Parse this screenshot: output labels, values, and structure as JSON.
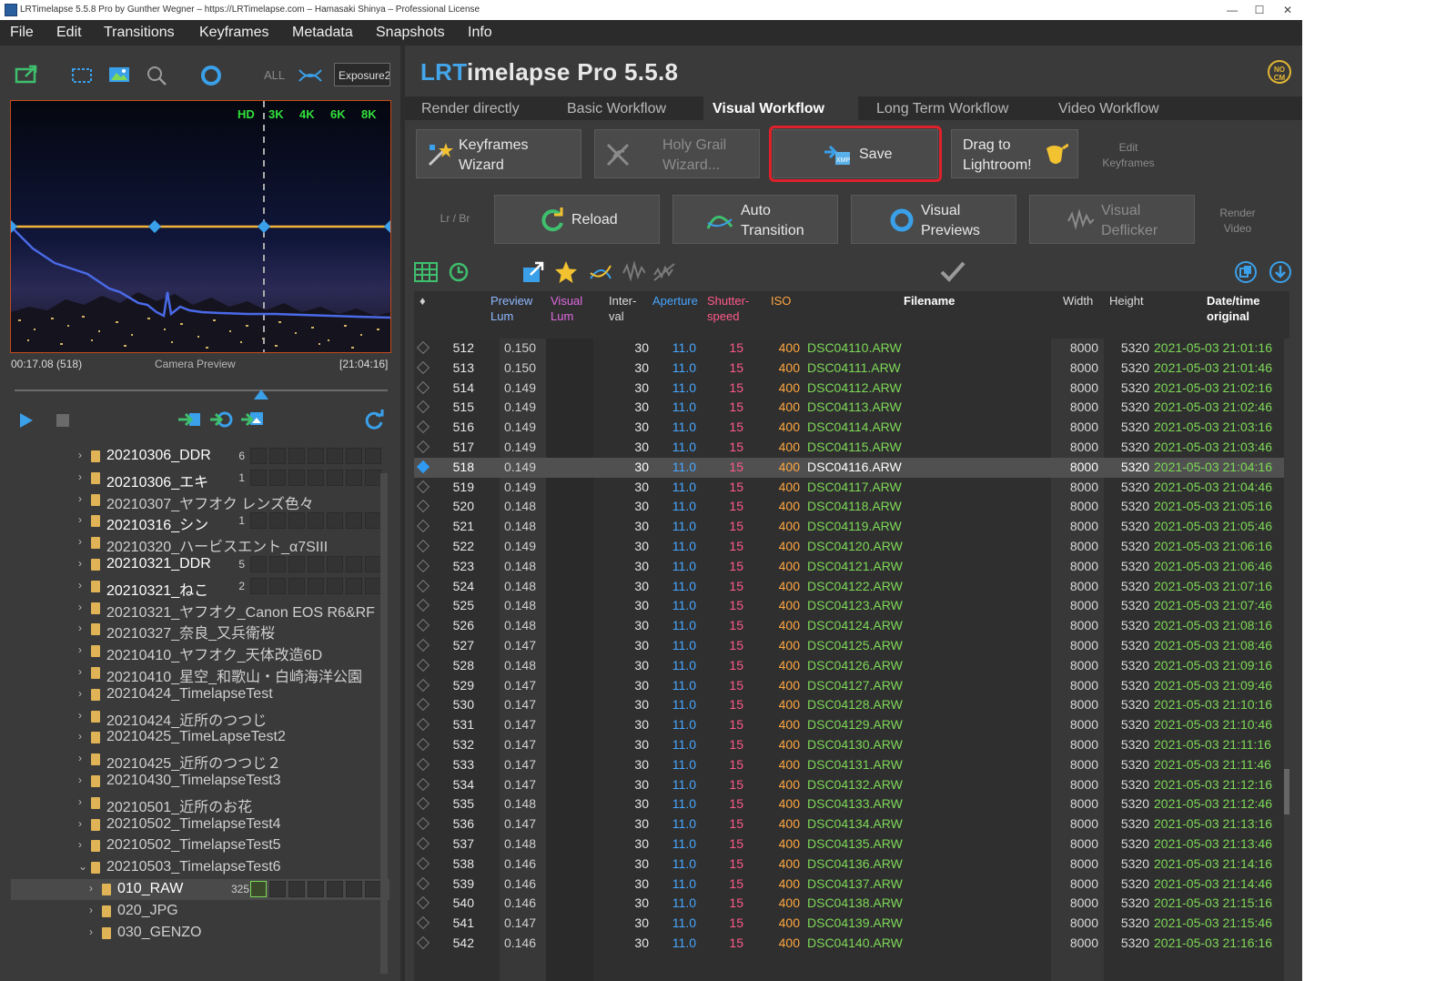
{
  "window": {
    "title": "LRTimelapse 5.5.8 Pro by Gunther Wegner – https://LRTimelapse.com – Hamasaki Shinya – Professional License",
    "minimize": "—",
    "maximize": "☐",
    "close": "✕"
  },
  "menu": [
    "File",
    "Edit",
    "Transitions",
    "Keyframes",
    "Metadata",
    "Snapshots",
    "Info"
  ],
  "left_toolbar": {
    "all_label": "ALL",
    "exposure_select": "Exposure2"
  },
  "preview": {
    "resolutions": [
      "HD",
      "3K",
      "4K",
      "6K",
      "8K"
    ],
    "time_left": "00:17.08 (518)",
    "label": "Camera Preview",
    "time_right": "[21:04:16]"
  },
  "folders": [
    {
      "name": "20210306_DDR",
      "count": "6",
      "bright": true,
      "cells": true
    },
    {
      "name": "20210306_エキ",
      "count": "1",
      "bright": true,
      "cells": true
    },
    {
      "name": "20210307_ヤフオク レンズ色々",
      "count": "",
      "bright": false,
      "cells": false
    },
    {
      "name": "20210316_シン",
      "count": "1",
      "bright": true,
      "cells": true
    },
    {
      "name": "20210320_ハービスエント_α7SIII",
      "count": "",
      "bright": false,
      "cells": false
    },
    {
      "name": "20210321_DDR",
      "count": "5",
      "bright": true,
      "cells": true
    },
    {
      "name": "20210321_ねこ",
      "count": "2",
      "bright": true,
      "cells": true
    },
    {
      "name": "20210321_ヤフオク_Canon EOS R6&RF",
      "count": "",
      "bright": false,
      "cells": false
    },
    {
      "name": "20210327_奈良_又兵衛桜",
      "count": "",
      "bright": false,
      "cells": false
    },
    {
      "name": "20210410_ヤフオク_天体改造6D",
      "count": "",
      "bright": false,
      "cells": false
    },
    {
      "name": "20210410_星空_和歌山・白崎海洋公園",
      "count": "",
      "bright": false,
      "cells": false
    },
    {
      "name": "20210424_TimelapseTest",
      "count": "",
      "bright": false,
      "cells": false
    },
    {
      "name": "20210424_近所のつつじ",
      "count": "",
      "bright": false,
      "cells": false
    },
    {
      "name": "20210425_TimeLapseTest2",
      "count": "",
      "bright": false,
      "cells": false
    },
    {
      "name": "20210425_近所のつつじ２",
      "count": "",
      "bright": false,
      "cells": false
    },
    {
      "name": "20210430_TimelapseTest3",
      "count": "",
      "bright": false,
      "cells": false
    },
    {
      "name": "20210501_近所のお花",
      "count": "",
      "bright": false,
      "cells": false
    },
    {
      "name": "20210502_TimelapseTest4",
      "count": "",
      "bright": false,
      "cells": false
    },
    {
      "name": "20210502_TimelapseTest5",
      "count": "",
      "bright": false,
      "cells": false
    },
    {
      "name": "20210503_TimelapseTest6",
      "count": "",
      "bright": false,
      "cells": false,
      "expanded": true
    },
    {
      "name": "010_RAW",
      "count": "325",
      "bright": true,
      "cells": true,
      "child": true,
      "selected": true
    },
    {
      "name": "020_JPG",
      "count": "",
      "bright": false,
      "cells": false,
      "child": true
    },
    {
      "name": "030_GENZO",
      "count": "",
      "bright": false,
      "cells": false,
      "child": true
    }
  ],
  "app_title": {
    "lrt": "LRT",
    "rest": "imelapse Pro 5.5.8"
  },
  "nocm": "NO CM",
  "tabs": [
    "Render directly",
    "Basic Workflow",
    "Visual Workflow",
    "Long Term Workflow",
    "Video Workflow"
  ],
  "active_tab": "Visual Workflow",
  "workflow_row1": {
    "keyframes_wizard": "Keyframes\nWizard",
    "holy_grail": "Holy Grail\nWizard...",
    "save": "Save",
    "drag_to_lr": "Drag to\nLightroom!",
    "edit_keyframes": "Edit\nKeyframes"
  },
  "workflow_row2": {
    "lr_br": "Lr / Br",
    "reload": "Reload",
    "auto_transition": "Auto\nTransition",
    "visual_previews": "Visual\nPreviews",
    "visual_deflicker": "Visual\nDeflicker",
    "render_video": "Render\nVideo"
  },
  "table": {
    "headers": {
      "sort": "♦",
      "preview_lum": "Preview\nLum",
      "visual_lum": "Visual\nLum",
      "interval": "Inter-\nval",
      "aperture": "Aperture",
      "shutter": "Shutter-\nspeed",
      "iso": "ISO",
      "filename": "Filename",
      "width": "Width",
      "height": "Height",
      "datetime": "Date/time\noriginal"
    },
    "rows": [
      {
        "n": "512",
        "lum": "0.150",
        "iv": "30",
        "ap": "11.0",
        "sh": "15",
        "iso": "400",
        "file": "DSC04110.ARW",
        "w": "8000",
        "h": "5320",
        "dt": "2021-05-03 21:01:16"
      },
      {
        "n": "513",
        "lum": "0.150",
        "iv": "30",
        "ap": "11.0",
        "sh": "15",
        "iso": "400",
        "file": "DSC04111.ARW",
        "w": "8000",
        "h": "5320",
        "dt": "2021-05-03 21:01:46"
      },
      {
        "n": "514",
        "lum": "0.149",
        "iv": "30",
        "ap": "11.0",
        "sh": "15",
        "iso": "400",
        "file": "DSC04112.ARW",
        "w": "8000",
        "h": "5320",
        "dt": "2021-05-03 21:02:16"
      },
      {
        "n": "515",
        "lum": "0.149",
        "iv": "30",
        "ap": "11.0",
        "sh": "15",
        "iso": "400",
        "file": "DSC04113.ARW",
        "w": "8000",
        "h": "5320",
        "dt": "2021-05-03 21:02:46"
      },
      {
        "n": "516",
        "lum": "0.149",
        "iv": "30",
        "ap": "11.0",
        "sh": "15",
        "iso": "400",
        "file": "DSC04114.ARW",
        "w": "8000",
        "h": "5320",
        "dt": "2021-05-03 21:03:16"
      },
      {
        "n": "517",
        "lum": "0.149",
        "iv": "30",
        "ap": "11.0",
        "sh": "15",
        "iso": "400",
        "file": "DSC04115.ARW",
        "w": "8000",
        "h": "5320",
        "dt": "2021-05-03 21:03:46"
      },
      {
        "n": "518",
        "lum": "0.149",
        "iv": "30",
        "ap": "11.0",
        "sh": "15",
        "iso": "400",
        "file": "DSC04116.ARW",
        "w": "8000",
        "h": "5320",
        "dt": "2021-05-03 21:04:16",
        "sel": true,
        "key": true
      },
      {
        "n": "519",
        "lum": "0.149",
        "iv": "30",
        "ap": "11.0",
        "sh": "15",
        "iso": "400",
        "file": "DSC04117.ARW",
        "w": "8000",
        "h": "5320",
        "dt": "2021-05-03 21:04:46"
      },
      {
        "n": "520",
        "lum": "0.148",
        "iv": "30",
        "ap": "11.0",
        "sh": "15",
        "iso": "400",
        "file": "DSC04118.ARW",
        "w": "8000",
        "h": "5320",
        "dt": "2021-05-03 21:05:16"
      },
      {
        "n": "521",
        "lum": "0.148",
        "iv": "30",
        "ap": "11.0",
        "sh": "15",
        "iso": "400",
        "file": "DSC04119.ARW",
        "w": "8000",
        "h": "5320",
        "dt": "2021-05-03 21:05:46"
      },
      {
        "n": "522",
        "lum": "0.149",
        "iv": "30",
        "ap": "11.0",
        "sh": "15",
        "iso": "400",
        "file": "DSC04120.ARW",
        "w": "8000",
        "h": "5320",
        "dt": "2021-05-03 21:06:16"
      },
      {
        "n": "523",
        "lum": "0.148",
        "iv": "30",
        "ap": "11.0",
        "sh": "15",
        "iso": "400",
        "file": "DSC04121.ARW",
        "w": "8000",
        "h": "5320",
        "dt": "2021-05-03 21:06:46"
      },
      {
        "n": "524",
        "lum": "0.148",
        "iv": "30",
        "ap": "11.0",
        "sh": "15",
        "iso": "400",
        "file": "DSC04122.ARW",
        "w": "8000",
        "h": "5320",
        "dt": "2021-05-03 21:07:16"
      },
      {
        "n": "525",
        "lum": "0.148",
        "iv": "30",
        "ap": "11.0",
        "sh": "15",
        "iso": "400",
        "file": "DSC04123.ARW",
        "w": "8000",
        "h": "5320",
        "dt": "2021-05-03 21:07:46"
      },
      {
        "n": "526",
        "lum": "0.148",
        "iv": "30",
        "ap": "11.0",
        "sh": "15",
        "iso": "400",
        "file": "DSC04124.ARW",
        "w": "8000",
        "h": "5320",
        "dt": "2021-05-03 21:08:16"
      },
      {
        "n": "527",
        "lum": "0.147",
        "iv": "30",
        "ap": "11.0",
        "sh": "15",
        "iso": "400",
        "file": "DSC04125.ARW",
        "w": "8000",
        "h": "5320",
        "dt": "2021-05-03 21:08:46"
      },
      {
        "n": "528",
        "lum": "0.148",
        "iv": "30",
        "ap": "11.0",
        "sh": "15",
        "iso": "400",
        "file": "DSC04126.ARW",
        "w": "8000",
        "h": "5320",
        "dt": "2021-05-03 21:09:16"
      },
      {
        "n": "529",
        "lum": "0.147",
        "iv": "30",
        "ap": "11.0",
        "sh": "15",
        "iso": "400",
        "file": "DSC04127.ARW",
        "w": "8000",
        "h": "5320",
        "dt": "2021-05-03 21:09:46"
      },
      {
        "n": "530",
        "lum": "0.147",
        "iv": "30",
        "ap": "11.0",
        "sh": "15",
        "iso": "400",
        "file": "DSC04128.ARW",
        "w": "8000",
        "h": "5320",
        "dt": "2021-05-03 21:10:16"
      },
      {
        "n": "531",
        "lum": "0.147",
        "iv": "30",
        "ap": "11.0",
        "sh": "15",
        "iso": "400",
        "file": "DSC04129.ARW",
        "w": "8000",
        "h": "5320",
        "dt": "2021-05-03 21:10:46"
      },
      {
        "n": "532",
        "lum": "0.147",
        "iv": "30",
        "ap": "11.0",
        "sh": "15",
        "iso": "400",
        "file": "DSC04130.ARW",
        "w": "8000",
        "h": "5320",
        "dt": "2021-05-03 21:11:16"
      },
      {
        "n": "533",
        "lum": "0.147",
        "iv": "30",
        "ap": "11.0",
        "sh": "15",
        "iso": "400",
        "file": "DSC04131.ARW",
        "w": "8000",
        "h": "5320",
        "dt": "2021-05-03 21:11:46"
      },
      {
        "n": "534",
        "lum": "0.147",
        "iv": "30",
        "ap": "11.0",
        "sh": "15",
        "iso": "400",
        "file": "DSC04132.ARW",
        "w": "8000",
        "h": "5320",
        "dt": "2021-05-03 21:12:16"
      },
      {
        "n": "535",
        "lum": "0.148",
        "iv": "30",
        "ap": "11.0",
        "sh": "15",
        "iso": "400",
        "file": "DSC04133.ARW",
        "w": "8000",
        "h": "5320",
        "dt": "2021-05-03 21:12:46"
      },
      {
        "n": "536",
        "lum": "0.147",
        "iv": "30",
        "ap": "11.0",
        "sh": "15",
        "iso": "400",
        "file": "DSC04134.ARW",
        "w": "8000",
        "h": "5320",
        "dt": "2021-05-03 21:13:16"
      },
      {
        "n": "537",
        "lum": "0.148",
        "iv": "30",
        "ap": "11.0",
        "sh": "15",
        "iso": "400",
        "file": "DSC04135.ARW",
        "w": "8000",
        "h": "5320",
        "dt": "2021-05-03 21:13:46"
      },
      {
        "n": "538",
        "lum": "0.146",
        "iv": "30",
        "ap": "11.0",
        "sh": "15",
        "iso": "400",
        "file": "DSC04136.ARW",
        "w": "8000",
        "h": "5320",
        "dt": "2021-05-03 21:14:16"
      },
      {
        "n": "539",
        "lum": "0.146",
        "iv": "30",
        "ap": "11.0",
        "sh": "15",
        "iso": "400",
        "file": "DSC04137.ARW",
        "w": "8000",
        "h": "5320",
        "dt": "2021-05-03 21:14:46"
      },
      {
        "n": "540",
        "lum": "0.146",
        "iv": "30",
        "ap": "11.0",
        "sh": "15",
        "iso": "400",
        "file": "DSC04138.ARW",
        "w": "8000",
        "h": "5320",
        "dt": "2021-05-03 21:15:16"
      },
      {
        "n": "541",
        "lum": "0.147",
        "iv": "30",
        "ap": "11.0",
        "sh": "15",
        "iso": "400",
        "file": "DSC04139.ARW",
        "w": "8000",
        "h": "5320",
        "dt": "2021-05-03 21:15:46"
      },
      {
        "n": "542",
        "lum": "0.146",
        "iv": "30",
        "ap": "11.0",
        "sh": "15",
        "iso": "400",
        "file": "DSC04140.ARW",
        "w": "8000",
        "h": "5320",
        "dt": "2021-05-03 21:16:16"
      }
    ]
  },
  "colors": {
    "accent_blue": "#44a6ea",
    "preview_lum": "#8fb8ff",
    "visual_lum": "#e06ae0",
    "aperture": "#46a6ff",
    "shutter": "#ff5a8a",
    "iso": "#ffa640",
    "filename": "#7ed957",
    "datetime": "#7ed957",
    "save_highlight": "#e0212b"
  }
}
